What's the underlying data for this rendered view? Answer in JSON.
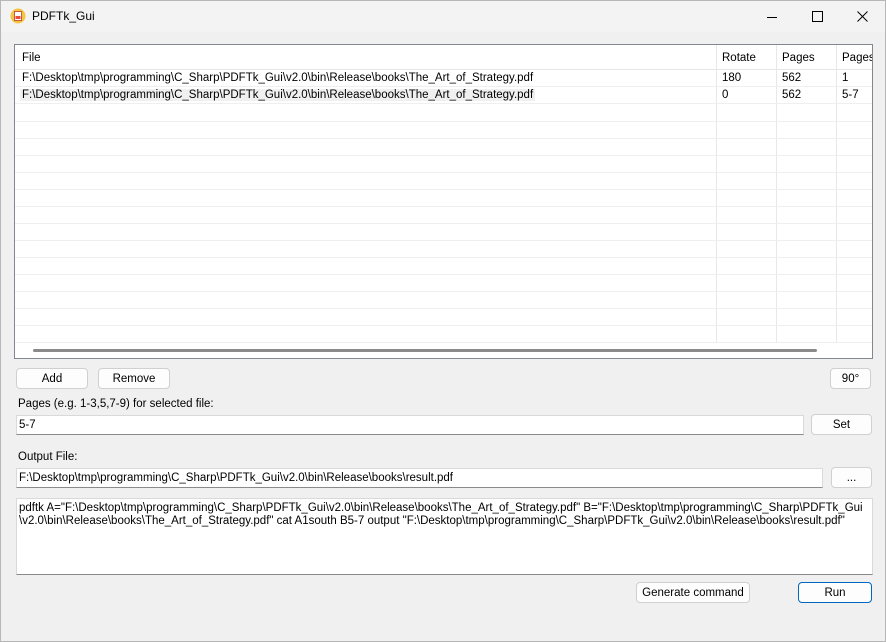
{
  "window": {
    "title": "PDFTk_Gui"
  },
  "list": {
    "columns": [
      "File",
      "Rotate",
      "Pages",
      "Pages"
    ],
    "rows": [
      {
        "file": "F:\\Desktop\\tmp\\programming\\C_Sharp\\PDFTk_Gui\\v2.0\\bin\\Release\\books\\The_Art_of_Strategy.pdf",
        "rotate": "180",
        "pages": "562",
        "selected_pages": "1"
      },
      {
        "file": "F:\\Desktop\\tmp\\programming\\C_Sharp\\PDFTk_Gui\\v2.0\\bin\\Release\\books\\The_Art_of_Strategy.pdf",
        "rotate": "0",
        "pages": "562",
        "selected_pages": "5-7"
      }
    ]
  },
  "buttons": {
    "add": "Add",
    "remove": "Remove",
    "rotate": "90°",
    "set": "Set",
    "browse": "...",
    "generate": "Generate command",
    "run": "Run"
  },
  "pages_field": {
    "label": "Pages (e.g. 1-3,5,7-9) for selected file:",
    "value": "5-7"
  },
  "output_field": {
    "label": "Output File:",
    "value": "F:\\Desktop\\tmp\\programming\\C_Sharp\\PDFTk_Gui\\v2.0\\bin\\Release\\books\\result.pdf"
  },
  "command": {
    "line1": "pdftk A=\"F:\\Desktop\\tmp\\programming\\C_Sharp\\PDFTk_Gui\\v2.0\\bin\\Release\\books\\The_Art_of_Strategy.pdf\" B=\"F:\\Desktop\\tmp\\programming\\C_Sharp\\PDFTk_Gui",
    "line2": "\\v2.0\\bin\\Release\\books\\The_Art_of_Strategy.pdf\" cat A1south B5-7 output \"F:\\Desktop\\tmp\\programming\\C_Sharp\\PDFTk_Gui\\v2.0\\bin\\Release\\books\\result.pdf\""
  },
  "colors": {
    "accent": "#0067c0",
    "background": "#f0f0f0"
  }
}
